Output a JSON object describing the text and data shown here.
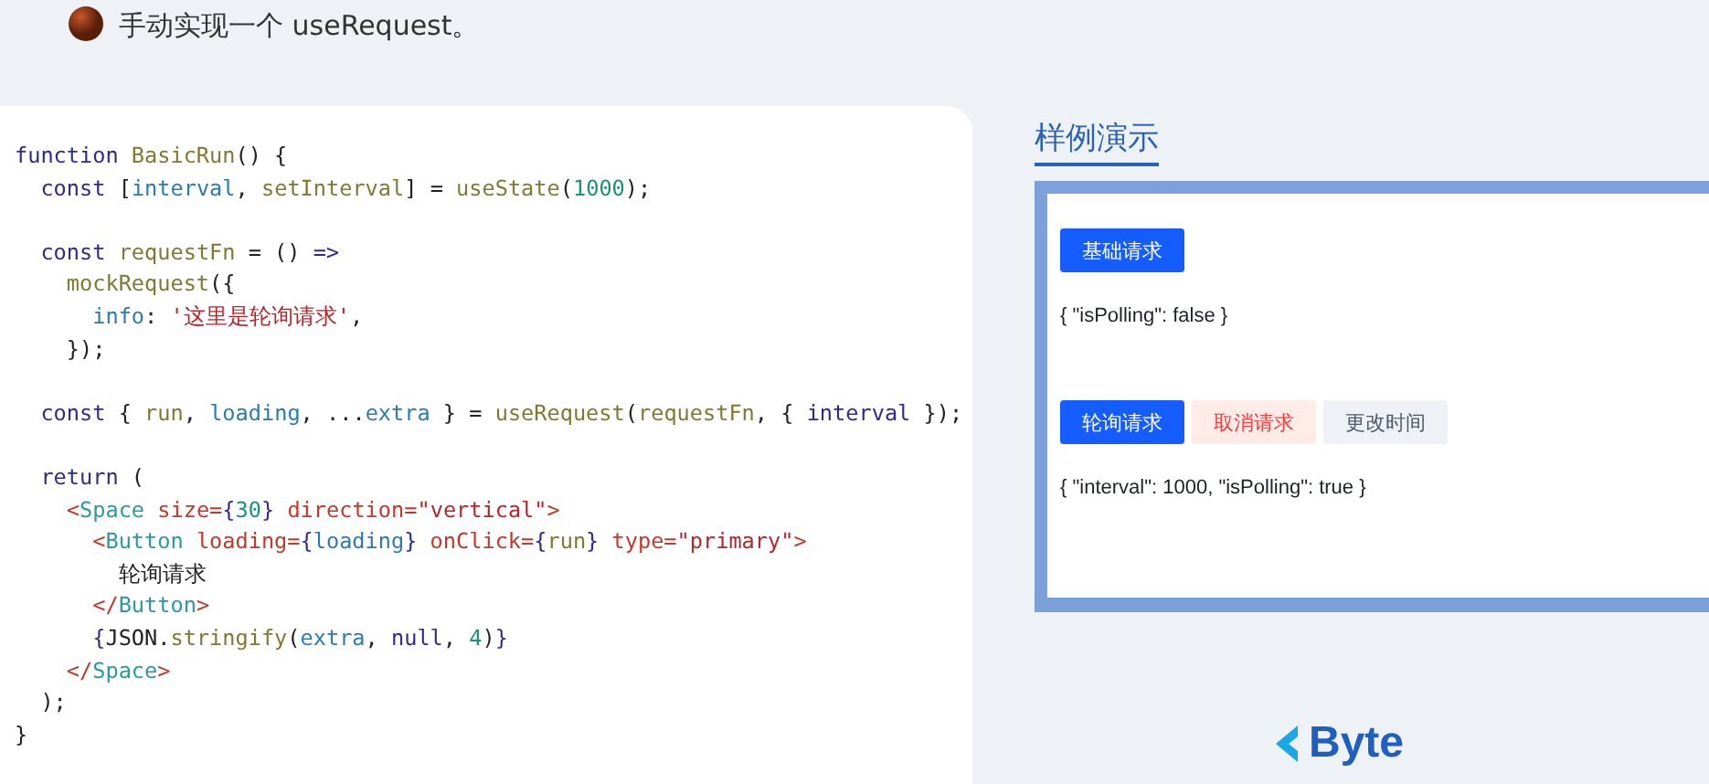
{
  "heading": {
    "text": "手动实现一个 useRequest。"
  },
  "code": {
    "lines": [
      {
        "gap_before": false,
        "tokens": [
          {
            "kind": "kw",
            "text": "function "
          },
          {
            "kind": "fn",
            "text": "BasicRun"
          },
          {
            "kind": "p",
            "text": "() {"
          }
        ]
      },
      {
        "gap_before": false,
        "tokens": [
          {
            "kind": "kw",
            "text": "  const "
          },
          {
            "kind": "p",
            "text": "["
          },
          {
            "kind": "var",
            "text": "interval"
          },
          {
            "kind": "p",
            "text": ", "
          },
          {
            "kind": "fn",
            "text": "setInterval"
          },
          {
            "kind": "p",
            "text": "] = "
          },
          {
            "kind": "fn",
            "text": "useState"
          },
          {
            "kind": "p",
            "text": "("
          },
          {
            "kind": "num",
            "text": "1000"
          },
          {
            "kind": "p",
            "text": ");"
          }
        ]
      },
      {
        "gap_before": true,
        "tokens": [
          {
            "kind": "kw",
            "text": "  const "
          },
          {
            "kind": "fn",
            "text": "requestFn"
          },
          {
            "kind": "p",
            "text": " = () "
          },
          {
            "kind": "kw",
            "text": "=>"
          }
        ]
      },
      {
        "gap_before": false,
        "tokens": [
          {
            "kind": "fn",
            "text": "    mockRequest"
          },
          {
            "kind": "p",
            "text": "({"
          }
        ]
      },
      {
        "gap_before": false,
        "tokens": [
          {
            "kind": "var",
            "text": "      info"
          },
          {
            "kind": "p",
            "text": ": "
          },
          {
            "kind": "str",
            "text": "'这里是轮询请求'"
          },
          {
            "kind": "p",
            "text": ","
          }
        ]
      },
      {
        "gap_before": false,
        "tokens": [
          {
            "kind": "p",
            "text": "    });"
          }
        ]
      },
      {
        "gap_before": true,
        "tokens": [
          {
            "kind": "kw",
            "text": "  const "
          },
          {
            "kind": "p",
            "text": "{ "
          },
          {
            "kind": "fn",
            "text": "run"
          },
          {
            "kind": "p",
            "text": ", "
          },
          {
            "kind": "var",
            "text": "loading"
          },
          {
            "kind": "p",
            "text": ", ..."
          },
          {
            "kind": "var",
            "text": "extra"
          },
          {
            "kind": "p",
            "text": " } = "
          },
          {
            "kind": "fn",
            "text": "useRequest"
          },
          {
            "kind": "p",
            "text": "("
          },
          {
            "kind": "fn",
            "text": "requestFn"
          },
          {
            "kind": "p",
            "text": ", { "
          },
          {
            "kind": "kw",
            "text": "interval"
          },
          {
            "kind": "p",
            "text": " });"
          }
        ]
      },
      {
        "gap_before": true,
        "tokens": [
          {
            "kind": "kw",
            "text": "  return "
          },
          {
            "kind": "p",
            "text": "("
          }
        ]
      },
      {
        "gap_before": false,
        "tokens": [
          {
            "kind": "attr",
            "text": "    <"
          },
          {
            "kind": "tag",
            "text": "Space "
          },
          {
            "kind": "attr",
            "text": "size="
          },
          {
            "kind": "kw",
            "text": "{"
          },
          {
            "kind": "num",
            "text": "30"
          },
          {
            "kind": "kw",
            "text": "}"
          },
          {
            "kind": "attr",
            "text": " direction="
          },
          {
            "kind": "str",
            "text": "\"vertical\""
          },
          {
            "kind": "attr",
            "text": ">"
          }
        ]
      },
      {
        "gap_before": false,
        "tokens": [
          {
            "kind": "attr",
            "text": "      <"
          },
          {
            "kind": "tag",
            "text": "Button "
          },
          {
            "kind": "attr",
            "text": "loading="
          },
          {
            "kind": "kw",
            "text": "{"
          },
          {
            "kind": "var",
            "text": "loading"
          },
          {
            "kind": "kw",
            "text": "}"
          },
          {
            "kind": "attr",
            "text": " onClick="
          },
          {
            "kind": "kw",
            "text": "{"
          },
          {
            "kind": "fn",
            "text": "run"
          },
          {
            "kind": "kw",
            "text": "}"
          },
          {
            "kind": "attr",
            "text": " type="
          },
          {
            "kind": "str",
            "text": "\"primary\""
          },
          {
            "kind": "attr",
            "text": ">"
          }
        ]
      },
      {
        "gap_before": false,
        "tokens": [
          {
            "kind": "p",
            "text": "        轮询请求"
          }
        ]
      },
      {
        "gap_before": false,
        "tokens": [
          {
            "kind": "attr",
            "text": "      </"
          },
          {
            "kind": "tag",
            "text": "Button"
          },
          {
            "kind": "attr",
            "text": ">"
          }
        ]
      },
      {
        "gap_before": false,
        "tokens": [
          {
            "kind": "kw",
            "text": "      {"
          },
          {
            "kind": "p",
            "text": "JSON."
          },
          {
            "kind": "fn",
            "text": "stringify"
          },
          {
            "kind": "p",
            "text": "("
          },
          {
            "kind": "var",
            "text": "extra"
          },
          {
            "kind": "p",
            "text": ", "
          },
          {
            "kind": "kw",
            "text": "null"
          },
          {
            "kind": "p",
            "text": ", "
          },
          {
            "kind": "num",
            "text": "4"
          },
          {
            "kind": "p",
            "text": ")"
          },
          {
            "kind": "kw",
            "text": "}"
          }
        ]
      },
      {
        "gap_before": false,
        "tokens": [
          {
            "kind": "attr",
            "text": "    </"
          },
          {
            "kind": "tag",
            "text": "Space"
          },
          {
            "kind": "attr",
            "text": ">"
          }
        ]
      },
      {
        "gap_before": false,
        "tokens": [
          {
            "kind": "p",
            "text": "  );"
          }
        ]
      },
      {
        "gap_before": false,
        "tokens": [
          {
            "kind": "p",
            "text": "}"
          }
        ]
      }
    ]
  },
  "demo": {
    "title": "样例演示",
    "sections": [
      {
        "buttons": [
          {
            "kind": "primary",
            "label": "基础请求"
          }
        ],
        "output": "{ \"isPolling\": false }"
      },
      {
        "buttons": [
          {
            "kind": "primary",
            "label": "轮询请求"
          },
          {
            "kind": "danger",
            "label": "取消请求"
          },
          {
            "kind": "secondary",
            "label": "更改时间"
          }
        ],
        "output": "{ \"interval\": 1000, \"isPolling\": true }"
      }
    ]
  },
  "logo": {
    "text": "Byte"
  }
}
